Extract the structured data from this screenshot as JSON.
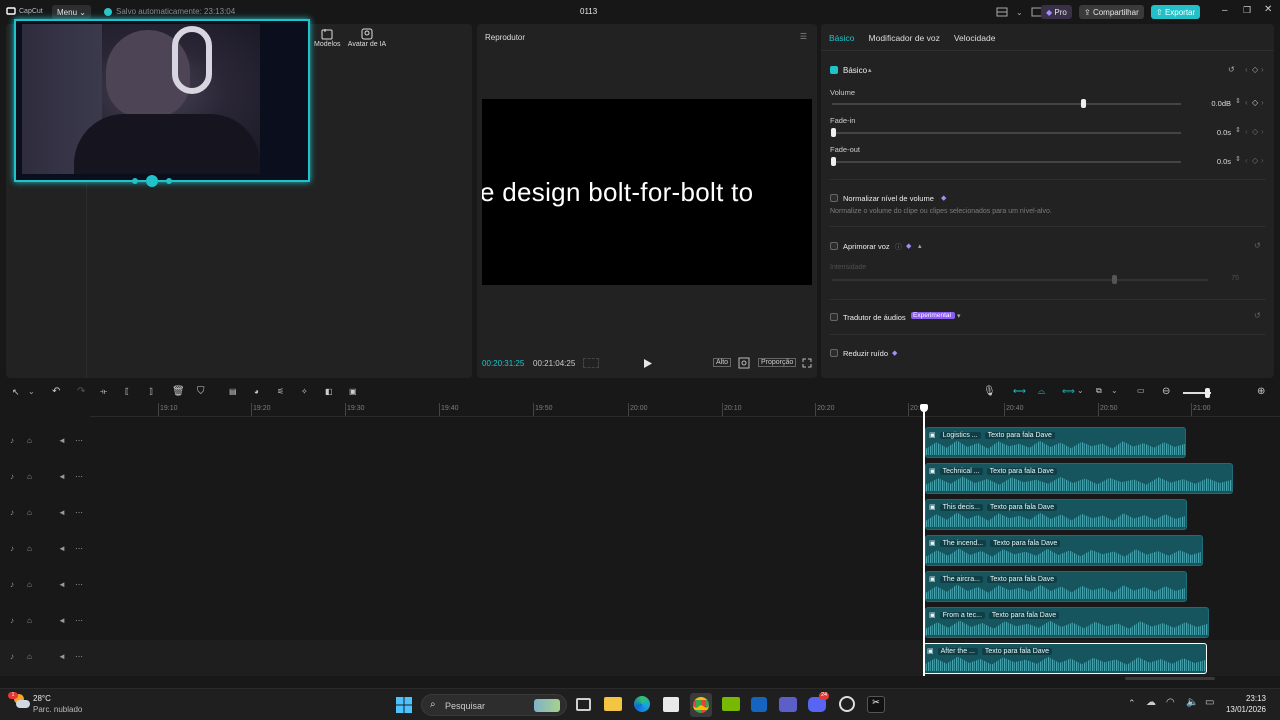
{
  "titlebar": {
    "app_name": "CapCut",
    "menu_label": "Menu",
    "autosave": "Salvo automaticamente: 23:13:04",
    "project_title": "0113",
    "pro_label": "Pro",
    "share_label": "Compartilhar",
    "export_label": "Exportar"
  },
  "left_panel": {
    "tools": [
      {
        "label": "Modelos",
        "icon": "template-icon"
      },
      {
        "label": "Avatar de IA",
        "icon": "ai-avatar-icon"
      }
    ]
  },
  "player": {
    "title": "Reprodutor",
    "caption_text": "e design bolt-for-bolt to",
    "current_time": "00:20:31:25",
    "total_time": "00:21:04:25",
    "quality_label": "Alto",
    "ratio_label": "Proporção"
  },
  "properties": {
    "tabs": [
      "Básico",
      "Modificador de voz",
      "Velocidade"
    ],
    "active_tab": "Básico",
    "basic_section": "Básico",
    "volume": {
      "label": "Volume",
      "value": "0.0dB",
      "level": 0.72
    },
    "fade_in": {
      "label": "Fade-in",
      "value": "0.0s",
      "level": 0
    },
    "fade_out": {
      "label": "Fade-out",
      "value": "0.0s",
      "level": 0
    },
    "normalize": {
      "label": "Normalizar nível de volume",
      "desc": "Normalize o volume do clipe ou clipes selecionados para um nível-alvo."
    },
    "enhance": {
      "label": "Aprimorar voz",
      "intensity_label": "Intensidade",
      "intensity_value": "75"
    },
    "translator": {
      "label": "Tradutor de áudios",
      "badge": "Experimental"
    },
    "noise": {
      "label": "Reduzir ruído"
    }
  },
  "timeline": {
    "ruler_ticks": [
      "19:10",
      "19:20",
      "19:30",
      "19:40",
      "19:50",
      "20:00",
      "20:10",
      "20:20",
      "20:30",
      "20:40",
      "20:50",
      "21:00"
    ],
    "tracks": [
      {
        "title": "Logistics ...",
        "voice": "Texto para fala Dave"
      },
      {
        "title": "Technical ...",
        "voice": "Texto para fala Dave"
      },
      {
        "title": "This decis...",
        "voice": "Texto para fala Dave"
      },
      {
        "title": "The incend...",
        "voice": "Texto para fala Dave"
      },
      {
        "title": "The aircra...",
        "voice": "Texto para fala Dave"
      },
      {
        "title": "From a tec...",
        "voice": "Texto para fala Dave"
      },
      {
        "title": "After the ...",
        "voice": "Texto para fala Dave"
      }
    ]
  },
  "taskbar": {
    "weather_temp": "28°C",
    "weather_desc": "Parc. nublado",
    "search_placeholder": "Pesquisar",
    "time": "23:13",
    "date": "13/01/2026",
    "discord_badge": "24"
  },
  "colors": {
    "accent": "#1fc3c9",
    "clip": "#17555e",
    "export": "#22c0c8"
  }
}
